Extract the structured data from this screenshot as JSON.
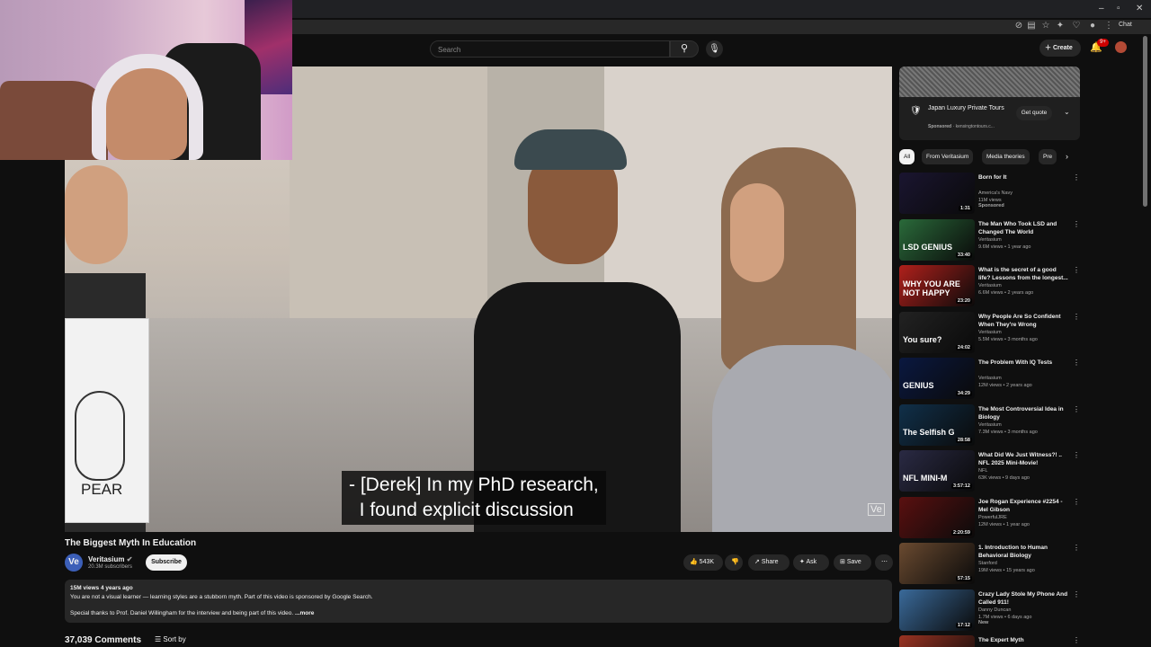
{
  "browser": {
    "chat_label": "Chat"
  },
  "header": {
    "search_placeholder": "Search",
    "create_label": "Create",
    "notification_count": "9+"
  },
  "video": {
    "subtitle_lines": "- [Derek] In my PhD research,\n  I found explicit discussion",
    "card_label": "PEAR",
    "watermark": "Ve",
    "title": "The Biggest Myth In Education",
    "channel_name": "Veritasium",
    "channel_initials": "Ve",
    "subscribers": "20.3M subscribers",
    "subscribe_label": "Subscribe",
    "likes": "543K",
    "share_label": "Share",
    "ask_label": "Ask",
    "save_label": "Save"
  },
  "description": {
    "stats": "15M views  4 years ago",
    "line1": "You are not a visual learner — learning styles are a stubborn myth. Part of this video is sponsored by Google Search.",
    "line2": "Special thanks to Prof. Daniel Willingham for the interview and being part of this video.",
    "more_label": "...more"
  },
  "comments": {
    "count_label": "37,039 Comments",
    "sort_label": "Sort by"
  },
  "ad": {
    "title": "Japan Luxury Private Tours",
    "sponsored": "Sponsored",
    "url": "kensingtontours.c...",
    "cta": "Get quote"
  },
  "chips": [
    "All",
    "From Veritasium",
    "Media theories",
    "Pre"
  ],
  "recommendations": [
    {
      "title": "Born for It",
      "channel": "America's Navy",
      "meta": "11M views",
      "extra": "Sponsored",
      "duration": "1:31",
      "thumb_text": "",
      "color": "#1a1530"
    },
    {
      "title": "The Man Who Took LSD and Changed The World",
      "channel": "Veritasium",
      "meta": "9.6M views • 1 year ago",
      "extra": "",
      "duration": "33:40",
      "thumb_text": "LSD GENIUS",
      "color": "#2a6a3a"
    },
    {
      "title": "What is the secret of a good life? Lessons from the longest...",
      "channel": "Veritasium",
      "meta": "6.6M views • 2 years ago",
      "extra": "",
      "duration": "23:20",
      "thumb_text": "WHY YOU ARE NOT HAPPY",
      "color": "#b0201b"
    },
    {
      "title": "Why People Are So Confident When They're Wrong",
      "channel": "Veritasium",
      "meta": "5.5M views • 3 months ago",
      "extra": "",
      "duration": "24:02",
      "thumb_text": "You sure?",
      "color": "#222222"
    },
    {
      "title": "The Problem With IQ Tests",
      "channel": "Veritasium",
      "meta": "12M views • 2 years ago",
      "extra": "",
      "duration": "34:29",
      "thumb_text": "GENIUS",
      "color": "#0a1840"
    },
    {
      "title": "The Most Controversial Idea in Biology",
      "channel": "Veritasium",
      "meta": "7.3M views • 3 months ago",
      "extra": "",
      "duration": "28:58",
      "thumb_text": "The Selfish G",
      "color": "#10304a"
    },
    {
      "title": "What Did We Just Witness?! .. NFL 2025 Mini-Movie!",
      "channel": "NFL",
      "meta": "63K views • 9 days ago",
      "extra": "",
      "duration": "3:57:12",
      "thumb_text": "NFL MINI-M",
      "color": "#2a2a44"
    },
    {
      "title": "Joe Rogan Experience #2254 - Mel Gibson",
      "channel": "PowerfulJRE",
      "meta": "12M views • 1 year ago",
      "extra": "",
      "duration": "2:20:59",
      "thumb_text": "",
      "color": "#5a1010"
    },
    {
      "title": "1. Introduction to Human Behavioral Biology",
      "channel": "Stanford",
      "meta": "19M views • 15 years ago",
      "extra": "",
      "duration": "57:15",
      "thumb_text": "",
      "color": "#6a4a30"
    },
    {
      "title": "Crazy Lady Stole My Phone And Called 911!",
      "channel": "Danny Duncan",
      "meta": "1.7M views • 6 days ago",
      "extra": "New",
      "duration": "17:12",
      "thumb_text": "",
      "color": "#3a6a9a"
    },
    {
      "title": "The Expert Myth",
      "channel": "",
      "meta": "",
      "extra": "",
      "duration": "",
      "thumb_text": "",
      "color": "#993322"
    }
  ]
}
